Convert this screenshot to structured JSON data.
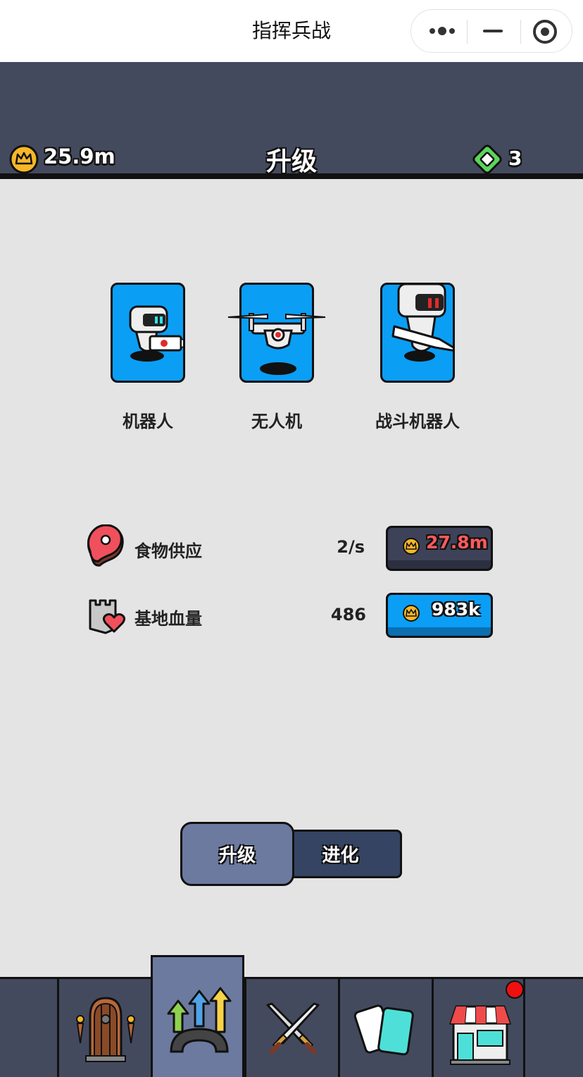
{
  "window": {
    "title": "指挥兵战"
  },
  "header": {
    "coins": "25.9m",
    "title": "升级",
    "gems": "3"
  },
  "units": [
    {
      "name": "机器人",
      "icon": "robot-icon"
    },
    {
      "name": "无人机",
      "icon": "drone-icon"
    },
    {
      "name": "战斗机器人",
      "icon": "combat-robot-icon"
    }
  ],
  "upgrades": [
    {
      "label": "食物供应",
      "value": "2/s",
      "cost": "27.8m",
      "icon": "meat-icon",
      "affordable": false
    },
    {
      "label": "基地血量",
      "value": "486",
      "cost": "983k",
      "icon": "castle-heart-icon",
      "affordable": true
    }
  ],
  "segments": {
    "upgrade": "升级",
    "evolve": "进化",
    "active": "upgrade"
  },
  "nav": {
    "items": [
      {
        "name": "gate",
        "icon": "door-icon"
      },
      {
        "name": "upgrade",
        "icon": "upgrade-arrows-icon"
      },
      {
        "name": "battle",
        "icon": "crossed-swords-icon"
      },
      {
        "name": "cards",
        "icon": "cards-icon"
      },
      {
        "name": "shop",
        "icon": "shop-icon"
      }
    ],
    "active": "upgrade",
    "shop_badge": true
  },
  "colors": {
    "header_bg": "#444a5e",
    "content_bg": "#e4e4e4",
    "card_blue": "#0b9ef5",
    "cost_unaffordable": "#ff5a5a",
    "button_disabled": "#3d4258",
    "button_blue": "#0b9ef5",
    "segment_active": "#6d7aa0",
    "segment_inactive": "#354462"
  }
}
